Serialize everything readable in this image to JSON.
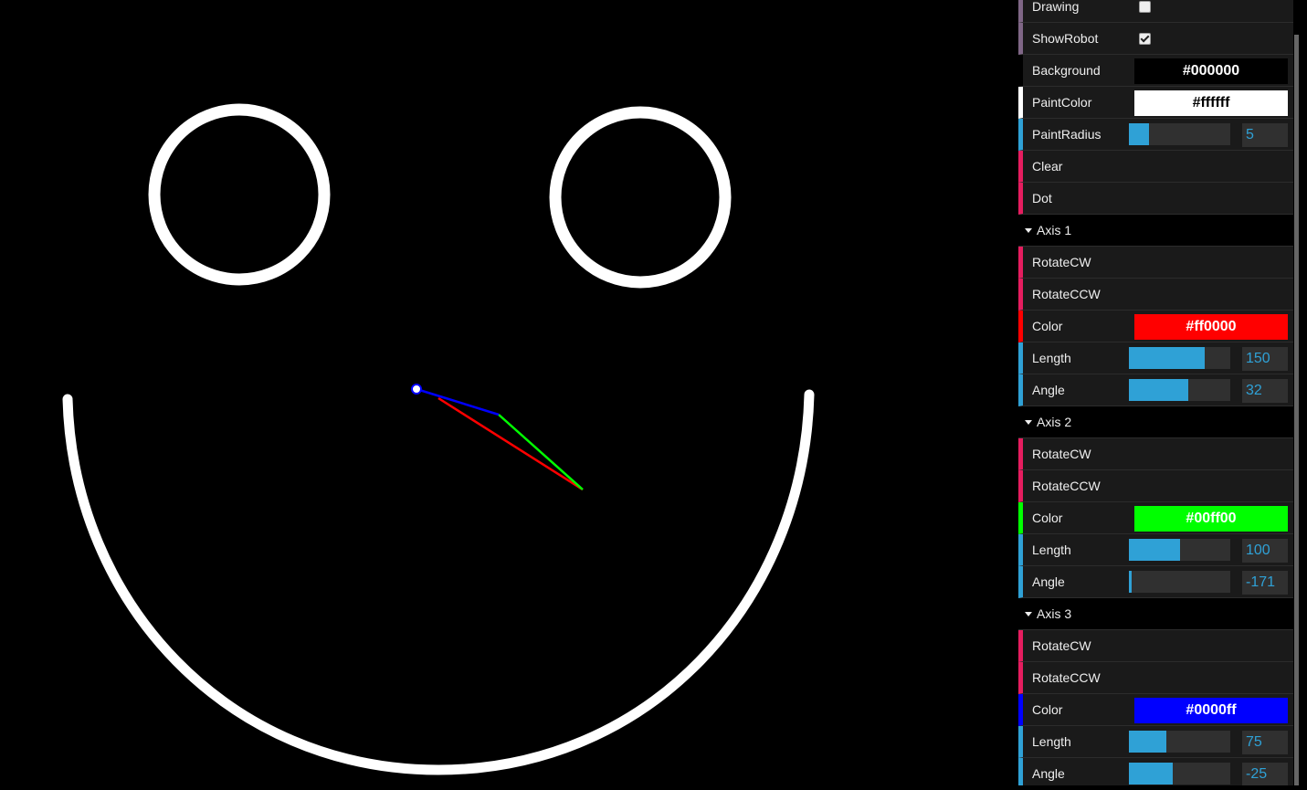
{
  "canvas": {
    "background": "#000000",
    "paint_color": "#ffffff"
  },
  "gui": {
    "drawing": {
      "label": "Drawing",
      "checked": false
    },
    "show_robot": {
      "label": "ShowRobot",
      "checked": true
    },
    "background": {
      "label": "Background",
      "value": "#000000"
    },
    "paint_color": {
      "label": "PaintColor",
      "value": "#ffffff"
    },
    "paint_radius": {
      "label": "PaintRadius",
      "value": "5",
      "fill": 0.2
    },
    "clear": {
      "label": "Clear"
    },
    "dot": {
      "label": "Dot"
    },
    "axes": [
      {
        "title": "Axis 1",
        "rotate_cw": "RotateCW",
        "rotate_ccw": "RotateCCW",
        "color_label": "Color",
        "color": "#ff0000",
        "length_label": "Length",
        "length": "150",
        "length_fill": 0.75,
        "angle_label": "Angle",
        "angle": "32",
        "angle_fill": 0.59
      },
      {
        "title": "Axis 2",
        "rotate_cw": "RotateCW",
        "rotate_ccw": "RotateCCW",
        "color_label": "Color",
        "color": "#00ff00",
        "length_label": "Length",
        "length": "100",
        "length_fill": 0.5,
        "angle_label": "Angle",
        "angle": "-171",
        "angle_fill": 0.025
      },
      {
        "title": "Axis 3",
        "rotate_cw": "RotateCW",
        "rotate_ccw": "RotateCCW",
        "color_label": "Color",
        "color": "#0000ff",
        "length_label": "Length",
        "length": "75",
        "length_fill": 0.37,
        "angle_label": "Angle",
        "angle": "-25",
        "angle_fill": 0.43
      }
    ]
  }
}
